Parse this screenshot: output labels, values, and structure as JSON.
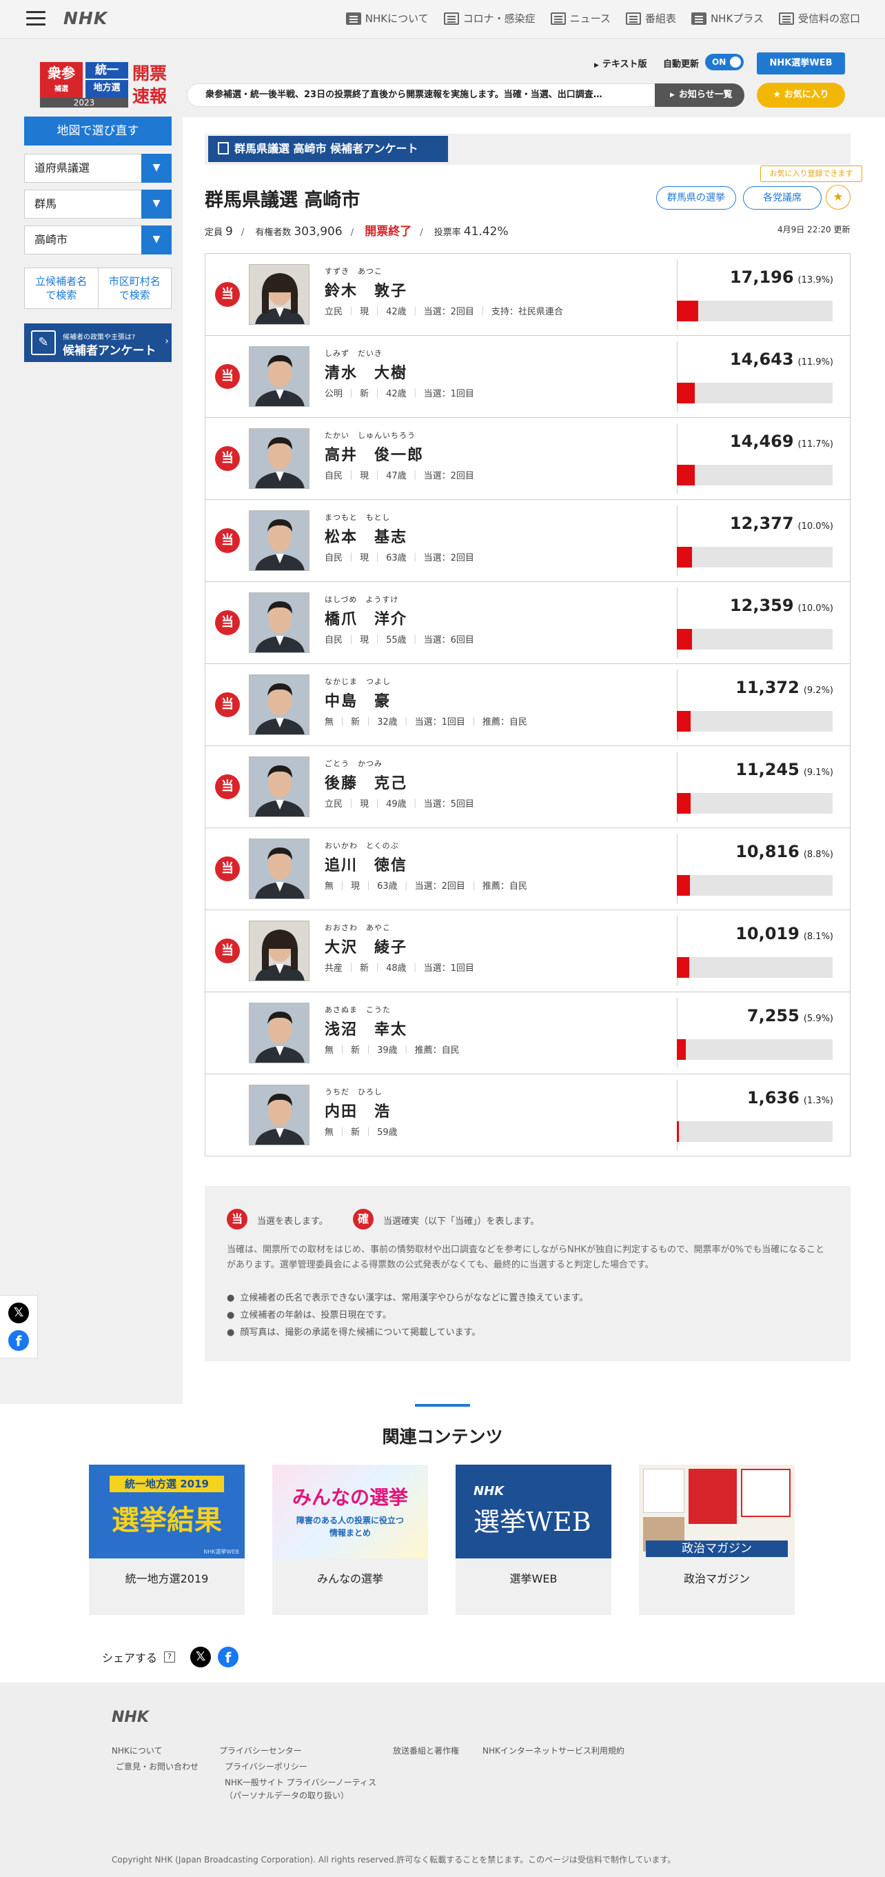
{
  "header": {
    "logo": "NHK",
    "nav": [
      {
        "label": "NHKについて",
        "icon": "nhk-icon"
      },
      {
        "label": "コロナ・感染症",
        "icon": "corona-icon"
      },
      {
        "label": "ニュース",
        "icon": "news-icon"
      },
      {
        "label": "番組表",
        "icon": "grid-icon"
      },
      {
        "label": "NHKプラス",
        "icon": "nhkplus-icon"
      },
      {
        "label": "受信料の窓口",
        "icon": "tv-icon"
      }
    ]
  },
  "election_logo": {
    "shu": "衆参",
    "shu_sub": "補選",
    "toitsu1": "統一",
    "toitsu2": "地方選",
    "year": "2023",
    "kaihyo1": "開票",
    "kaihyo2": "速報"
  },
  "controls": {
    "text_version": "テキスト版",
    "auto_update": "自動更新",
    "toggle": "ON",
    "web_button": "NHK選挙WEB",
    "ticker": "衆参補選・統一後半戦、23日の投票終了直後から開票速報を実施します。当確・当選、出口調査…",
    "notice_button": "お知らせ一覧",
    "favorite_button": "★ お気に入り"
  },
  "sidebar": {
    "map_button": "地図で選び直す",
    "selects": [
      "道府県議選",
      "群馬",
      "高崎市"
    ],
    "search_links": [
      {
        "line1": "立候補者名",
        "line2": "で検索"
      },
      {
        "line1": "市区町村名",
        "line2": "で検索"
      }
    ],
    "survey_small": "候補者の政策や主張は?",
    "survey_main": "候補者アンケート"
  },
  "main": {
    "tag": "群馬県議選 高崎市 候補者アンケート",
    "title": "群馬県議選 高崎市",
    "fav_note": "お気に入り登録できます",
    "btn_pref": "群馬県の選挙",
    "btn_party": "各党議席",
    "stats": {
      "teiin_label": "定員",
      "teiin": "9",
      "voters_label": "有権者数",
      "voters": "303,906",
      "status": "開票終了",
      "turnout_label": "投票率",
      "turnout": "41.42%"
    },
    "updated": "4月9日 22:20 更新"
  },
  "candidates": [
    {
      "kana": "すずき　あつこ",
      "name": "鈴木　敦子",
      "party": "立民",
      "status": "現",
      "age": "42歳",
      "wins": "当選：2回目",
      "extra": "支持：社民県連合",
      "votes": "17,196",
      "pct": "(13.9%)",
      "win": true,
      "gender": "f"
    },
    {
      "kana": "しみず　だいき",
      "name": "清水　大樹",
      "party": "公明",
      "status": "新",
      "age": "42歳",
      "wins": "当選：1回目",
      "extra": "",
      "votes": "14,643",
      "pct": "(11.9%)",
      "win": true,
      "gender": "m"
    },
    {
      "kana": "たかい　しゅんいちろう",
      "name": "高井　俊一郎",
      "party": "自民",
      "status": "現",
      "age": "47歳",
      "wins": "当選：2回目",
      "extra": "",
      "votes": "14,469",
      "pct": "(11.7%)",
      "win": true,
      "gender": "m"
    },
    {
      "kana": "まつもと　もとし",
      "name": "松本　基志",
      "party": "自民",
      "status": "現",
      "age": "63歳",
      "wins": "当選：2回目",
      "extra": "",
      "votes": "12,377",
      "pct": "(10.0%)",
      "win": true,
      "gender": "m"
    },
    {
      "kana": "はしづめ　ようすけ",
      "name": "橋爪　洋介",
      "party": "自民",
      "status": "現",
      "age": "55歳",
      "wins": "当選：6回目",
      "extra": "",
      "votes": "12,359",
      "pct": "(10.0%)",
      "win": true,
      "gender": "m"
    },
    {
      "kana": "なかじま　つよし",
      "name": "中島　豪",
      "party": "無",
      "status": "新",
      "age": "32歳",
      "wins": "当選：1回目",
      "extra": "推薦：自民",
      "votes": "11,372",
      "pct": "(9.2%)",
      "win": true,
      "gender": "m"
    },
    {
      "kana": "ごとう　かつみ",
      "name": "後藤　克己",
      "party": "立民",
      "status": "現",
      "age": "49歳",
      "wins": "当選：5回目",
      "extra": "",
      "votes": "11,245",
      "pct": "(9.1%)",
      "win": true,
      "gender": "m"
    },
    {
      "kana": "おいかわ　とくのぶ",
      "name": "追川　徳信",
      "party": "無",
      "status": "現",
      "age": "63歳",
      "wins": "当選：2回目",
      "extra": "推薦：自民",
      "votes": "10,816",
      "pct": "(8.8%)",
      "win": true,
      "gender": "m"
    },
    {
      "kana": "おおさわ　あやこ",
      "name": "大沢　綾子",
      "party": "共産",
      "status": "新",
      "age": "48歳",
      "wins": "当選：1回目",
      "extra": "",
      "votes": "10,019",
      "pct": "(8.1%)",
      "win": true,
      "gender": "f"
    },
    {
      "kana": "あさぬま　こうた",
      "name": "浅沼　幸太",
      "party": "無",
      "status": "新",
      "age": "39歳",
      "wins": "",
      "extra": "推薦：自民",
      "votes": "7,255",
      "pct": "(5.9%)",
      "win": false,
      "gender": "m"
    },
    {
      "kana": "うちだ　ひろし",
      "name": "内田　浩",
      "party": "無",
      "status": "新",
      "age": "59歳",
      "wins": "",
      "extra": "",
      "votes": "1,636",
      "pct": "(1.3%)",
      "win": false,
      "gender": "m"
    }
  ],
  "candidate_bar_share": [
    13.9,
    11.9,
    11.7,
    10.0,
    10.0,
    9.2,
    9.1,
    8.8,
    8.1,
    5.9,
    1.3
  ],
  "win_mark": "当",
  "legend": {
    "badge1": "当",
    "text1": "当選を表します。",
    "badge2": "確",
    "text2": "当選確実（以下「当確」）を表します。",
    "para": "当確は、開票所での取材をはじめ、事前の情勢取材や出口調査などを参考にしながらNHKが独自に判定するもので、開票率が0%でも当確になることがあります。選挙管理委員会による得票数の公式発表がなくても、最終的に当選すると判定した場合です。",
    "items": [
      "立候補者の氏名で表示できない漢字は、常用漢字やひらがななどに置き換えています。",
      "立候補者の年齢は、投票日現在です。",
      "顔写真は、撮影の承諾を得た候補について掲載しています。"
    ]
  },
  "related": {
    "title": "関連コンテンツ",
    "cards": [
      {
        "label": "統一地方選2019",
        "img_line1": "統一地方選 2019",
        "img_line2": "選挙結果",
        "img_small": "NHK選挙WEB"
      },
      {
        "label": "みんなの選挙",
        "img_line1": "みんなの選挙",
        "img_line2": "障害のある人の投票に役立つ",
        "img_line3": "情報まとめ"
      },
      {
        "label": "選挙WEB",
        "img_line1": "NHK",
        "img_line2": "選挙WEB"
      },
      {
        "label": "政治マガジン",
        "img_line1": "政治マガジン"
      }
    ]
  },
  "share": {
    "label": "シェアする",
    "help": "?",
    "x": "𝕏",
    "f": "f"
  },
  "footer": {
    "logo": "NHK",
    "col1": [
      "NHKについて",
      "ご意見・お問い合わせ"
    ],
    "col2": [
      "プライバシーセンター",
      "プライバシーポリシー",
      "NHK一般サイト プライバシーノーティス",
      "（パーソナルデータの取り扱い）"
    ],
    "col3": [
      "放送番組と著作権"
    ],
    "col4": [
      "NHKインターネットサービス利用規約"
    ],
    "copyright": "Copyright NHK (Japan Broadcasting Corporation). All rights reserved.許可なく転載することを禁じます。このページは受信料で制作しています。"
  },
  "colors": {
    "accent": "#1f79d3",
    "win_red": "#d7252b",
    "bar_red": "#e00b10",
    "navy": "#1d4f93",
    "yellow": "#f2b705"
  }
}
